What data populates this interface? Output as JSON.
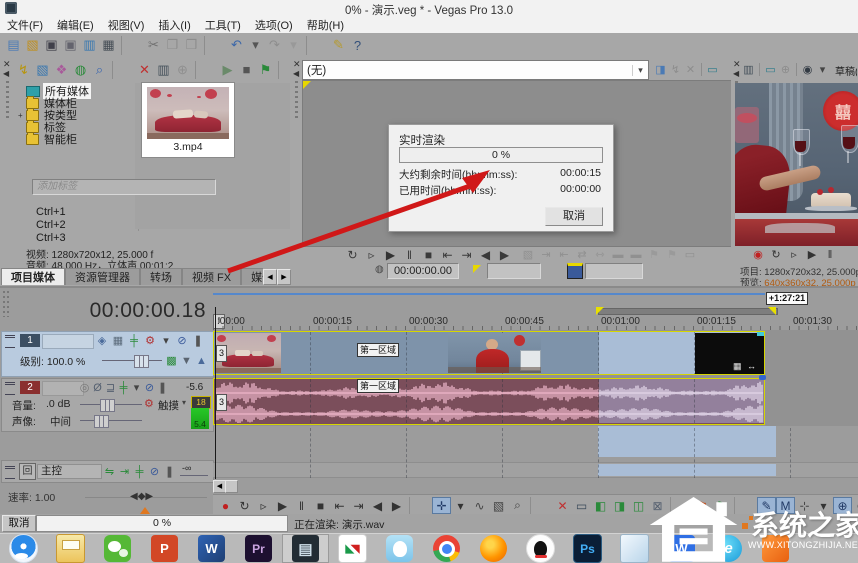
{
  "window": {
    "title": "0% - 演示.veg * - Vegas Pro 13.0"
  },
  "menu": [
    {
      "label": "文件(F)"
    },
    {
      "label": "编辑(E)"
    },
    {
      "label": "视图(V)"
    },
    {
      "label": "插入(I)"
    },
    {
      "label": "工具(T)"
    },
    {
      "label": "选项(O)"
    },
    {
      "label": "帮助(H)"
    }
  ],
  "main_toolbar": [
    {
      "n": "new-project-icon",
      "g": "▤",
      "c": "#4a7ab5"
    },
    {
      "n": "open-project-icon",
      "g": "▧",
      "c": "#c09020"
    },
    {
      "n": "save-icon",
      "g": "▣",
      "c": "#40404a"
    },
    {
      "n": "render-as-icon",
      "g": "▣",
      "c": "#63636d"
    },
    {
      "n": "import-media-icon",
      "g": "▥",
      "c": "#3a78b0"
    },
    {
      "n": "project-properties-icon",
      "g": "▦",
      "c": "#454d55"
    },
    {
      "n": "separator"
    },
    {
      "n": "cut-icon",
      "g": "✂",
      "c": "#707070"
    },
    {
      "n": "copy-icon",
      "g": "❐",
      "c": "#8d8d8d"
    },
    {
      "n": "paste-icon",
      "g": "❒",
      "c": "#8d8d8d"
    },
    {
      "n": "separator"
    },
    {
      "n": "undo-icon",
      "g": "↶",
      "c": "#3a66a8"
    },
    {
      "n": "undo-caret-icon",
      "g": "▾",
      "c": "#555555"
    },
    {
      "n": "redo-icon",
      "g": "↷",
      "c": "#8d8d8d"
    },
    {
      "n": "redo-caret-icon",
      "g": "▾",
      "c": "#999999"
    },
    {
      "n": "separator"
    },
    {
      "n": "interaction-icon",
      "g": "✎",
      "c": "#b59a30"
    },
    {
      "n": "help-icon",
      "g": "?",
      "c": "#33507a"
    }
  ],
  "media_panel": {
    "toolbar": [
      {
        "n": "autopreview-icon",
        "g": "↯",
        "c": "#b8950a"
      },
      {
        "n": "add-media-icon",
        "g": "▧",
        "c": "#3a78b0"
      },
      {
        "n": "capture-icon",
        "g": "❖",
        "c": "#a85a9a"
      },
      {
        "n": "get-media-web-icon",
        "g": "◍",
        "c": "#2a8a3a"
      },
      {
        "n": "search-media-icon",
        "g": "⌕",
        "c": "#3a66b0"
      },
      {
        "n": "separator"
      },
      {
        "n": "remove-media-icon",
        "g": "✕",
        "c": "#c03030"
      },
      {
        "n": "media-properties-icon",
        "g": "▥",
        "c": "#44505a"
      },
      {
        "n": "plugin-icon",
        "g": "⊕",
        "c": "#8f8f8f"
      },
      {
        "n": "separator"
      },
      {
        "n": "preview-start-icon",
        "g": "▶",
        "c": "#6a8a6a"
      },
      {
        "n": "preview-stop-icon",
        "g": "■",
        "c": "#555555"
      },
      {
        "n": "media-tag-icon",
        "g": "⚑",
        "c": "#2a8a3a"
      },
      {
        "n": "separator"
      },
      {
        "n": "views-icon",
        "g": "▦",
        "c": "#44505a"
      },
      {
        "n": "views-caret-icon",
        "g": "▾",
        "c": "#555555"
      },
      {
        "n": "separator"
      },
      {
        "n": "zoom-media-icon",
        "g": "⌕",
        "c": "#707070"
      }
    ],
    "tree": [
      {
        "label": "所有媒体",
        "k": "bin",
        "exp": "",
        "sel": "true"
      },
      {
        "label": "媒体柜",
        "k": "folder",
        "exp": ""
      },
      {
        "label": "按类型",
        "k": "folder",
        "exp": "+"
      },
      {
        "label": "标签",
        "k": "folder",
        "exp": ""
      },
      {
        "label": "智能柜",
        "k": "folder",
        "exp": ""
      }
    ],
    "thumb_caption": "3.mp4",
    "tag_placeholder": "添加标签",
    "shortcuts": [
      {
        "label": "Ctrl+1"
      },
      {
        "label": "Ctrl+2"
      },
      {
        "label": "Ctrl+3"
      }
    ],
    "info_line1": "视频: 1280x720x12, 25.000 f",
    "info_line2": "音频: 48,000 Hz，立体声 00:01:2",
    "tabs": [
      {
        "label": "项目媒体",
        "active": "true"
      },
      {
        "label": "资源管理器"
      },
      {
        "label": "转场"
      },
      {
        "label": "视频 FX"
      },
      {
        "label": "媒体生成器"
      }
    ]
  },
  "trimmer": {
    "combo_value": "(无)",
    "icons": [
      {
        "n": "open-in-trimmer-icon",
        "g": "◨",
        "c": "#4a7ab5"
      },
      {
        "n": "autopreview-icon",
        "g": "↯",
        "c": "#8d8d8d"
      },
      {
        "n": "close-trimmer-icon",
        "g": "✕",
        "c": "#8d8d8d"
      },
      {
        "n": "separator"
      },
      {
        "n": "external-monitor-icon",
        "g": "▭",
        "c": "#2a7a8a"
      }
    ],
    "transport": [
      {
        "n": "loop-playback-icon",
        "g": "↻",
        "c": "#3a3a3a"
      },
      {
        "n": "play-from-start-icon",
        "g": "▹",
        "c": "#3a3a3a"
      },
      {
        "n": "play-icon",
        "g": "▶",
        "c": "#333333"
      },
      {
        "n": "pause-icon",
        "g": "‖",
        "c": "#3a3a3a"
      },
      {
        "n": "stop-icon",
        "g": "■",
        "c": "#3a3a3a"
      },
      {
        "n": "go-to-start-icon",
        "g": "⇤",
        "c": "#3a3a3a"
      },
      {
        "n": "go-to-end-icon",
        "g": "⇥",
        "c": "#3a3a3a"
      },
      {
        "n": "prev-frame-icon",
        "g": "◀",
        "c": "#3a3a3a"
      },
      {
        "n": "next-frame-icon",
        "g": "▶",
        "c": "#3a3a3a"
      }
    ],
    "edit_icons": [
      {
        "n": "create-subclip-icon",
        "g": "▧",
        "c": "#909090"
      },
      {
        "n": "select-in-icon",
        "g": "⇥",
        "c": "#909090"
      },
      {
        "n": "select-out-icon",
        "g": "⇤",
        "c": "#909090"
      },
      {
        "n": "region-in-icon",
        "g": "⇄",
        "c": "#909090"
      },
      {
        "n": "region-out-icon",
        "g": "⇿",
        "c": "#909090"
      },
      {
        "n": "add-region1-icon",
        "g": "▬",
        "c": "#909090"
      },
      {
        "n": "add-region2-icon",
        "g": "▬",
        "c": "#909090"
      },
      {
        "n": "marker-icon",
        "g": "⚑",
        "c": "#9a9a9a"
      },
      {
        "n": "region-flags-icon",
        "g": "⚑",
        "c": "#9a9a9a"
      },
      {
        "n": "window-icon",
        "g": "▭",
        "c": "#909090"
      }
    ],
    "timecode": "00:00:00.00"
  },
  "dialog": {
    "title": "实时渲染",
    "progress_text": "0 %",
    "rows": [
      {
        "label": "大约剩余时间(hh:mm:ss):",
        "value": "00:00:15"
      },
      {
        "label": "已用时间(hh:mm:ss):",
        "value": "00:00:00"
      }
    ],
    "cancel_label": "取消"
  },
  "preview": {
    "toolbar": [
      {
        "n": "copy-snapshot-icon",
        "g": "▥",
        "c": "#44505a"
      },
      {
        "n": "separator"
      },
      {
        "n": "external-monitor-icon",
        "g": "▭",
        "c": "#2a7a8a"
      },
      {
        "n": "overlay-icon",
        "g": "⊕",
        "c": "#8d8d8d"
      },
      {
        "n": "separator"
      },
      {
        "n": "quality-icon",
        "g": "◉",
        "c": "#333b44"
      },
      {
        "n": "quality-caret-icon",
        "g": "▾",
        "c": "#444444"
      }
    ],
    "quality_label": "草稿(自",
    "transport": [
      {
        "n": "record-icon",
        "g": "◉",
        "c": "#c02020"
      },
      {
        "n": "loop-icon",
        "g": "↻",
        "c": "#333333"
      },
      {
        "n": "play-from-start-icon",
        "g": "▹",
        "c": "#333333"
      },
      {
        "n": "play-icon",
        "g": "▶",
        "c": "#333333"
      },
      {
        "n": "pause-icon",
        "g": "‖",
        "c": "#333333"
      }
    ],
    "info1_label": "项目:",
    "info1_value": "1280x720x32, 25.000p",
    "info2_label": "预览:",
    "info2_value": "640x360x32, 25.000p"
  },
  "timeline": {
    "timecode": "00:00:00.18",
    "ruler_labels": [
      ":00:00",
      "00:00:15",
      "00:00:30",
      "00:00:45",
      "00:01:00",
      "00:01:15",
      "00:01:30"
    ],
    "tooltip": "+1:27:21",
    "region_label": "第一区域",
    "take_label": "3",
    "track1": {
      "num": "1",
      "icons": [
        {
          "n": "compositing-icon",
          "g": "◈",
          "c": "#4a6a9a"
        },
        {
          "n": "parent-icon",
          "g": "▦",
          "c": "#5a6a7a"
        },
        {
          "n": "bypass-fx-icon",
          "g": "╪",
          "c": "#2a8a3a"
        },
        {
          "n": "automation-icon",
          "g": "⚙",
          "c": "#b03030"
        },
        {
          "n": "automation-caret-icon",
          "g": "▾",
          "c": "#444444"
        },
        {
          "n": "mute-icon",
          "g": "⊘",
          "c": "#3a5a9a"
        },
        {
          "n": "solo-icon",
          "g": "❚",
          "c": "#555555"
        }
      ],
      "level_label": "级别: 100.0 %",
      "icons2": [
        {
          "n": "track-fx-icon",
          "g": "▩",
          "c": "#2a8a3a"
        },
        {
          "n": "fade-down-icon",
          "g": "▼",
          "c": "#5a6470"
        },
        {
          "n": "fade-up-icon",
          "g": "▲",
          "c": "#4a6a9a"
        }
      ]
    },
    "track2": {
      "num": "2",
      "gain": "-5.6",
      "icons": [
        {
          "n": "arm-record-icon",
          "g": "◎",
          "c": "#777777"
        },
        {
          "n": "invert-phase-icon",
          "g": "Ø",
          "c": "#556070"
        },
        {
          "n": "eq-icon",
          "g": "⊒",
          "c": "#556070"
        },
        {
          "n": "bypass-fx-icon",
          "g": "╪",
          "c": "#2a8a3a"
        },
        {
          "n": "caret-icon",
          "g": "▾",
          "c": "#444444"
        },
        {
          "n": "mute-icon",
          "g": "⊘",
          "c": "#3a5a9a"
        },
        {
          "n": "solo-icon",
          "g": "❚",
          "c": "#555555"
        }
      ],
      "vol_label": "音量:",
      "vol_value": ".0 dB",
      "touch_label": "触摸",
      "pan_label": "声像:",
      "pan_value": "中间",
      "meter_top": "18",
      "meter_val": "5.4",
      "gear": "⚙"
    },
    "master": {
      "name": "主控",
      "icons": [
        {
          "n": "insert-bus-icon",
          "g": "⇋",
          "c": "#2a8a3a"
        },
        {
          "n": "insert-fx-icon",
          "g": "⇥",
          "c": "#2a8a3a"
        },
        {
          "n": "bypass-fx-icon",
          "g": "╪",
          "c": "#2a8a3a"
        },
        {
          "n": "mute-icon",
          "g": "⊘",
          "c": "#3a5a9a"
        },
        {
          "n": "solo-icon",
          "g": "❚",
          "c": "#555555"
        }
      ],
      "gain": "-∞",
      "box_icon": "回"
    },
    "rate_label": "速率: 1.00",
    "tools": [
      {
        "n": "record-icon",
        "g": "●",
        "c": "#c02020"
      },
      {
        "n": "loop-playback-icon",
        "g": "↻",
        "c": "#333333"
      },
      {
        "n": "play-from-start-icon",
        "g": "▹",
        "c": "#333333"
      },
      {
        "n": "play-icon",
        "g": "▶",
        "c": "#333333"
      },
      {
        "n": "pause-icon",
        "g": "‖",
        "c": "#333333"
      },
      {
        "n": "stop-icon",
        "g": "■",
        "c": "#333333"
      },
      {
        "n": "go-to-start-icon",
        "g": "⇤",
        "c": "#333333"
      },
      {
        "n": "go-to-end-icon",
        "g": "⇥",
        "c": "#333333"
      },
      {
        "n": "prev-frame-icon",
        "g": "◀",
        "c": "#333333"
      },
      {
        "n": "next-frame-icon",
        "g": "▶",
        "c": "#333333"
      },
      {
        "n": "separator"
      },
      {
        "n": "edit-tool-icon",
        "g": "✛",
        "c": "#223a66",
        "hl": "true"
      },
      {
        "n": "tool-caret-icon",
        "g": "▾",
        "c": "#333333"
      },
      {
        "n": "envelope-tool-icon",
        "g": "∿",
        "c": "#444444"
      },
      {
        "n": "selection-tool-icon",
        "g": "▧",
        "c": "#444444"
      },
      {
        "n": "zoom-tool-icon",
        "g": "⌕",
        "c": "#444444"
      },
      {
        "n": "separator"
      },
      {
        "n": "delete-icon",
        "g": "✕",
        "c": "#c03030"
      },
      {
        "n": "snap-icon",
        "g": "▭",
        "c": "#3a4a5a"
      },
      {
        "n": "fade-in-icon",
        "g": "◧",
        "c": "#2a8a3a"
      },
      {
        "n": "fade-out-icon",
        "g": "◨",
        "c": "#2a8a3a"
      },
      {
        "n": "crossfade-icon",
        "g": "◫",
        "c": "#2a8a3a"
      },
      {
        "n": "lock-icon",
        "g": "⊠",
        "c": "#556070"
      },
      {
        "n": "separator"
      },
      {
        "n": "marker-icon",
        "g": "⚑",
        "c": "#c05020"
      },
      {
        "n": "region-icon",
        "g": "⚑",
        "c": "#2a8a3a"
      },
      {
        "n": "separator"
      },
      {
        "n": "pen-tool-icon",
        "g": "✎",
        "c": "#223a66",
        "hl": "true"
      },
      {
        "n": "envelope-m-icon",
        "g": "M",
        "c": "#223a66",
        "hl": "true"
      },
      {
        "n": "expand-icon",
        "g": "⊹",
        "c": "#444444"
      },
      {
        "n": "caret2-icon",
        "g": "▾",
        "c": "#333333"
      },
      {
        "n": "group-icon",
        "g": "⊕",
        "c": "#223a66",
        "hl": "true"
      },
      {
        "n": "ungroup-icon",
        "g": "⊗",
        "c": "#444444"
      },
      {
        "n": "separator"
      },
      {
        "n": "delete2-icon",
        "g": "✕",
        "c": "#c03030"
      },
      {
        "n": "snap2-icon",
        "g": "▭",
        "c": "#3a4a5a"
      },
      {
        "n": "fade-in2-icon",
        "g": "◧",
        "c": "#2a8a3a"
      },
      {
        "n": "fade-out2-icon",
        "g": "◨",
        "c": "#2a8a3a"
      },
      {
        "n": "crossfade2-icon",
        "g": "◫",
        "c": "#2a8a3a"
      }
    ]
  },
  "status": {
    "cancel_label": "取消",
    "progress_text": "0 %",
    "message": "正在渲染: 演示.wav"
  },
  "taskbar": [
    {
      "n": "qq-browser-icon",
      "t": "",
      "k": "qqb"
    },
    {
      "n": "file-explorer-icon",
      "t": "",
      "k": "exp"
    },
    {
      "n": "wechat-icon",
      "t": "",
      "k": "wechat"
    },
    {
      "n": "powerpoint-icon",
      "t": "P",
      "k": "ppt"
    },
    {
      "n": "word-icon",
      "t": "W",
      "k": "word"
    },
    {
      "n": "premiere-icon",
      "t": "Pr",
      "k": "pr"
    },
    {
      "n": "vegas-icon",
      "t": "",
      "k": "vegas",
      "active": "true"
    },
    {
      "n": "coreldraw-icon",
      "t": "",
      "k": "cdr"
    },
    {
      "n": "tim-icon",
      "t": "",
      "k": "tim"
    },
    {
      "n": "chrome-icon",
      "t": "",
      "k": "chrome"
    },
    {
      "n": "browser-icon",
      "t": "",
      "k": "ff"
    },
    {
      "n": "qq-icon",
      "t": "",
      "k": "qq"
    },
    {
      "n": "photoshop-icon",
      "t": "Ps",
      "k": "ps"
    },
    {
      "n": "notepad-icon",
      "t": "",
      "k": "note"
    },
    {
      "n": "wps-icon",
      "t": "W",
      "k": "wps"
    },
    {
      "n": "edge-icon",
      "t": "e",
      "k": "edge"
    },
    {
      "n": "app-icon",
      "t": "",
      "k": "misc"
    }
  ],
  "watermark": {
    "text": "系统之家",
    "sub": "WWW.XITONGZHIJIA.NET"
  },
  "colors": {
    "waveform": "#e7afc3",
    "waveform_selected": "#ddd0e4",
    "selection": "#a9bdd6",
    "arrow": "#d01818"
  }
}
